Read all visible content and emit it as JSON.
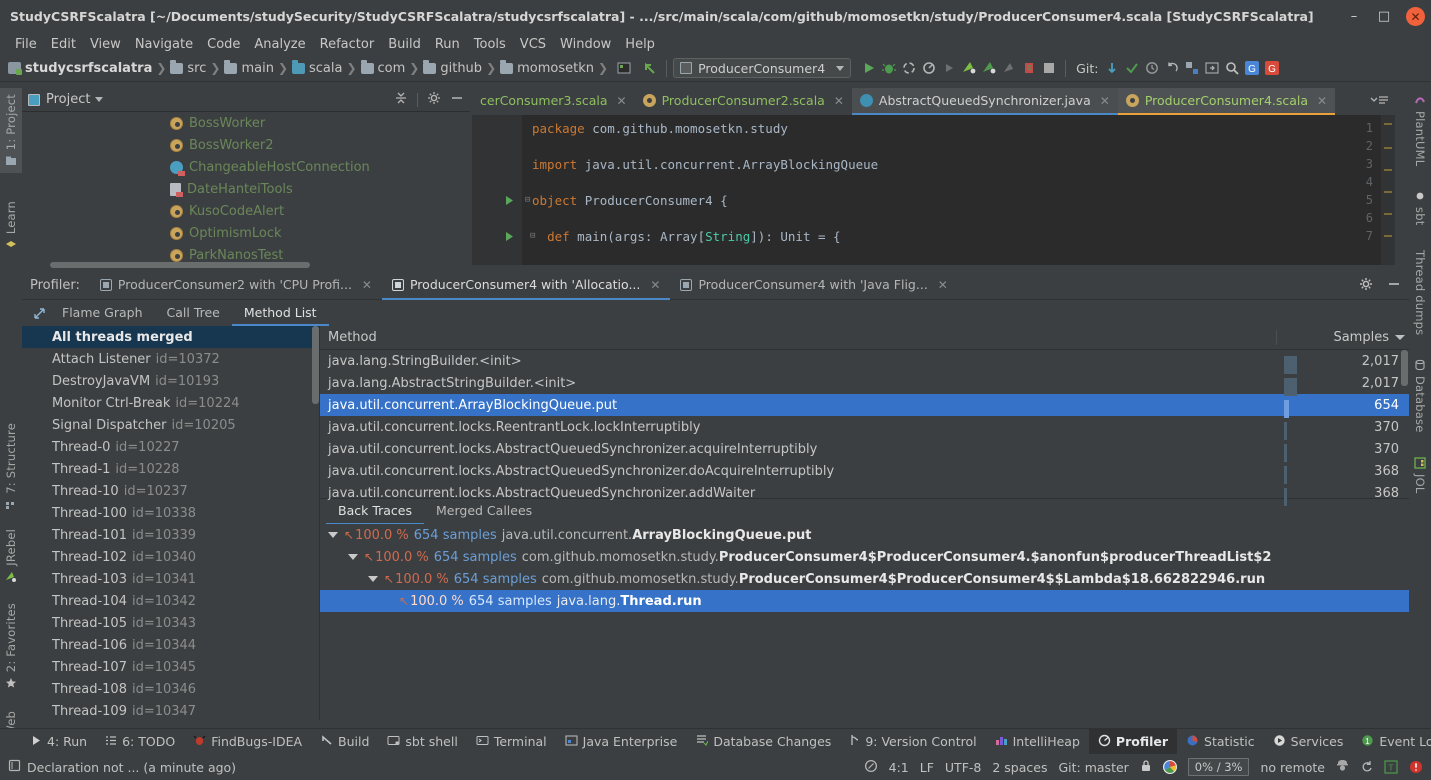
{
  "window": {
    "title": "StudyCSRFScalatra [~/Documents/studySecurity/StudyCSRFScalatra/studycsrfscalatra] - .../src/main/scala/com/github/momosetkn/study/ProducerConsumer4.scala [StudyCSRFScalatra]",
    "minimize": "–",
    "maximize": "□",
    "close": "✕"
  },
  "menu": [
    "File",
    "Edit",
    "View",
    "Navigate",
    "Code",
    "Analyze",
    "Refactor",
    "Build",
    "Run",
    "Tools",
    "VCS",
    "Window",
    "Help"
  ],
  "breadcrumbs": [
    "studycsrfscalatra",
    "src",
    "main",
    "scala",
    "com",
    "github",
    "momosetkn"
  ],
  "toolbar": {
    "run_config": "ProducerConsumer4",
    "git_label": "Git:"
  },
  "project_panel": {
    "title": "Project",
    "items": [
      {
        "label": "BossWorker",
        "icon": "scala-object-icon"
      },
      {
        "label": "BossWorker2",
        "icon": "scala-object-icon"
      },
      {
        "label": "ChangeableHostConnection",
        "icon": "scala-class-icon"
      },
      {
        "label": "DateHanteiTools",
        "icon": "file-icon"
      },
      {
        "label": "KusoCodeAlert",
        "icon": "scala-object-icon"
      },
      {
        "label": "OptimismLock",
        "icon": "scala-object-icon"
      },
      {
        "label": "ParkNanosTest",
        "icon": "scala-object-icon"
      }
    ]
  },
  "editor": {
    "tabs": [
      {
        "label": "cerConsumer3.scala",
        "icon": "scala-file-icon",
        "state": "normal"
      },
      {
        "label": "ProducerConsumer2.scala",
        "icon": "scala-object-icon",
        "state": "normal"
      },
      {
        "label": "AbstractQueuedSynchronizer.java",
        "icon": "java-class-icon",
        "state": "active-blue"
      },
      {
        "label": "ProducerConsumer4.scala",
        "icon": "scala-object-icon",
        "state": "active-selected"
      }
    ],
    "lines": [
      {
        "num": "1",
        "text": "package com.github.momosetkn.study",
        "kind": "package"
      },
      {
        "num": "2",
        "text": "",
        "kind": "blank"
      },
      {
        "num": "3",
        "text": "import java.util.concurrent.ArrayBlockingQueue",
        "kind": "import"
      },
      {
        "num": "4",
        "text": "",
        "kind": "blank"
      },
      {
        "num": "5",
        "text": "object ProducerConsumer4 {",
        "kind": "object"
      },
      {
        "num": "6",
        "text": "",
        "kind": "blank"
      },
      {
        "num": "7",
        "text": "  def main(args: Array[String]): Unit = {",
        "kind": "def"
      }
    ]
  },
  "left_rail": [
    {
      "label": "1: Project",
      "icon": "project-icon"
    },
    {
      "label": "Learn",
      "icon": "learn-icon"
    },
    {
      "label": "7: Structure",
      "icon": "structure-icon"
    },
    {
      "label": "JRebel",
      "icon": "jrebel-icon"
    },
    {
      "label": "2: Favorites",
      "icon": "star-icon"
    },
    {
      "label": "Web",
      "icon": "web-icon"
    }
  ],
  "right_rail": [
    {
      "label": "PlantUML",
      "icon": "plantuml-icon"
    },
    {
      "label": "sbt",
      "icon": "sbt-icon"
    },
    {
      "label": "Thread dumps",
      "icon": "thread-dumps-icon"
    },
    {
      "label": "Database",
      "icon": "database-icon"
    },
    {
      "label": "JOL",
      "icon": "jol-icon"
    }
  ],
  "profiler": {
    "label": "Profiler:",
    "tabs": [
      {
        "label": "ProducerConsumer2 with 'CPU Profi...",
        "active": false
      },
      {
        "label": "ProducerConsumer4 with 'Allocatio...",
        "active": true
      },
      {
        "label": "ProducerConsumer4 with 'Java Flig...",
        "active": false
      }
    ],
    "sub_tabs": [
      {
        "label": "Flame Graph",
        "active": false
      },
      {
        "label": "Call Tree",
        "active": false
      },
      {
        "label": "Method List",
        "active": true
      }
    ],
    "threads": [
      {
        "name": "All threads merged",
        "id": "",
        "selected": true
      },
      {
        "name": "Attach Listener",
        "id": "id=10372",
        "selected": false
      },
      {
        "name": "DestroyJavaVM",
        "id": "id=10193",
        "selected": false
      },
      {
        "name": "Monitor Ctrl-Break",
        "id": "id=10224",
        "selected": false
      },
      {
        "name": "Signal Dispatcher",
        "id": "id=10205",
        "selected": false
      },
      {
        "name": "Thread-0",
        "id": "id=10227",
        "selected": false
      },
      {
        "name": "Thread-1",
        "id": "id=10228",
        "selected": false
      },
      {
        "name": "Thread-10",
        "id": "id=10237",
        "selected": false
      },
      {
        "name": "Thread-100",
        "id": "id=10338",
        "selected": false
      },
      {
        "name": "Thread-101",
        "id": "id=10339",
        "selected": false
      },
      {
        "name": "Thread-102",
        "id": "id=10340",
        "selected": false
      },
      {
        "name": "Thread-103",
        "id": "id=10341",
        "selected": false
      },
      {
        "name": "Thread-104",
        "id": "id=10342",
        "selected": false
      },
      {
        "name": "Thread-105",
        "id": "id=10343",
        "selected": false
      },
      {
        "name": "Thread-106",
        "id": "id=10344",
        "selected": false
      },
      {
        "name": "Thread-107",
        "id": "id=10345",
        "selected": false
      },
      {
        "name": "Thread-108",
        "id": "id=10346",
        "selected": false
      },
      {
        "name": "Thread-109",
        "id": "id=10347",
        "selected": false
      }
    ],
    "method_columns": {
      "method": "Method",
      "samples": "Samples"
    },
    "methods": [
      {
        "name": "java.lang.StringBuilder.<init>",
        "samples": "2,017",
        "bar": 2017,
        "selected": false
      },
      {
        "name": "java.lang.AbstractStringBuilder.<init>",
        "samples": "2,017",
        "bar": 2017,
        "selected": false
      },
      {
        "name": "java.util.concurrent.ArrayBlockingQueue.put",
        "samples": "654",
        "bar": 654,
        "selected": true
      },
      {
        "name": "java.util.concurrent.locks.ReentrantLock.lockInterruptibly",
        "samples": "370",
        "bar": 370,
        "selected": false
      },
      {
        "name": "java.util.concurrent.locks.AbstractQueuedSynchronizer.acquireInterruptibly",
        "samples": "370",
        "bar": 370,
        "selected": false
      },
      {
        "name": "java.util.concurrent.locks.AbstractQueuedSynchronizer.doAcquireInterruptibly",
        "samples": "368",
        "bar": 368,
        "selected": false
      },
      {
        "name": "java.util.concurrent.locks.AbstractQueuedSynchronizer.addWaiter",
        "samples": "368",
        "bar": 368,
        "selected": false
      }
    ],
    "trace_tabs": [
      {
        "label": "Back Traces",
        "active": true
      },
      {
        "label": "Merged Callees",
        "active": false
      }
    ],
    "back_traces": [
      {
        "depth": 0,
        "expander": true,
        "pct": "100.0 %",
        "samples": "654 samples",
        "pkg": "java.util.concurrent.",
        "method": "ArrayBlockingQueue.put",
        "selected": false
      },
      {
        "depth": 1,
        "expander": true,
        "pct": "100.0 %",
        "samples": "654 samples",
        "pkg": "com.github.momosetkn.study.",
        "method": "ProducerConsumer4$ProducerConsumer4.$anonfun$producerThreadList$2",
        "selected": false
      },
      {
        "depth": 2,
        "expander": true,
        "pct": "100.0 %",
        "samples": "654 samples",
        "pkg": "com.github.momosetkn.study.",
        "method": "ProducerConsumer4$ProducerConsumer4$$Lambda$18.662822946.run",
        "selected": false
      },
      {
        "depth": 3,
        "expander": false,
        "pct": "100.0 %",
        "samples": "654 samples",
        "pkg": "java.lang.",
        "method": "Thread.run",
        "selected": true
      }
    ]
  },
  "tool_windows": [
    {
      "label": "4: Run",
      "icon": "run-icon",
      "active": false
    },
    {
      "label": "6: TODO",
      "icon": "todo-icon",
      "active": false
    },
    {
      "label": "FindBugs-IDEA",
      "icon": "findbugs-icon",
      "active": false
    },
    {
      "label": "Build",
      "icon": "build-icon",
      "active": false
    },
    {
      "label": "sbt shell",
      "icon": "sbt-shell-icon",
      "active": false
    },
    {
      "label": "Terminal",
      "icon": "terminal-icon",
      "active": false
    },
    {
      "label": "Java Enterprise",
      "icon": "java-enterprise-icon",
      "active": false
    },
    {
      "label": "Database Changes",
      "icon": "database-changes-icon",
      "active": false
    },
    {
      "label": "9: Version Control",
      "icon": "version-control-icon",
      "active": false
    },
    {
      "label": "IntelliHeap",
      "icon": "intelliheap-icon",
      "active": false
    },
    {
      "label": "Profiler",
      "icon": "profiler-icon",
      "active": true
    },
    {
      "label": "Statistic",
      "icon": "statistic-icon",
      "active": false
    },
    {
      "label": "Services",
      "icon": "services-icon",
      "active": false
    },
    {
      "label": "Event Lo",
      "icon": "event-log-icon",
      "active": false
    }
  ],
  "status_bar": {
    "message": "Declaration not ... (a minute ago)",
    "caret": "4:1",
    "line_sep": "LF",
    "encoding": "UTF-8",
    "indent": "2 spaces",
    "git_branch": "Git: master",
    "memory": "0% /  3%",
    "remote": "no remote"
  },
  "colors": {
    "accent_blue": "#3572c8",
    "tab_underline": "#4a88c7",
    "string_green": "#6a8759",
    "keyword_orange": "#cc7832",
    "percent_red": "#d06a4e",
    "close_red": "#f0613c"
  }
}
